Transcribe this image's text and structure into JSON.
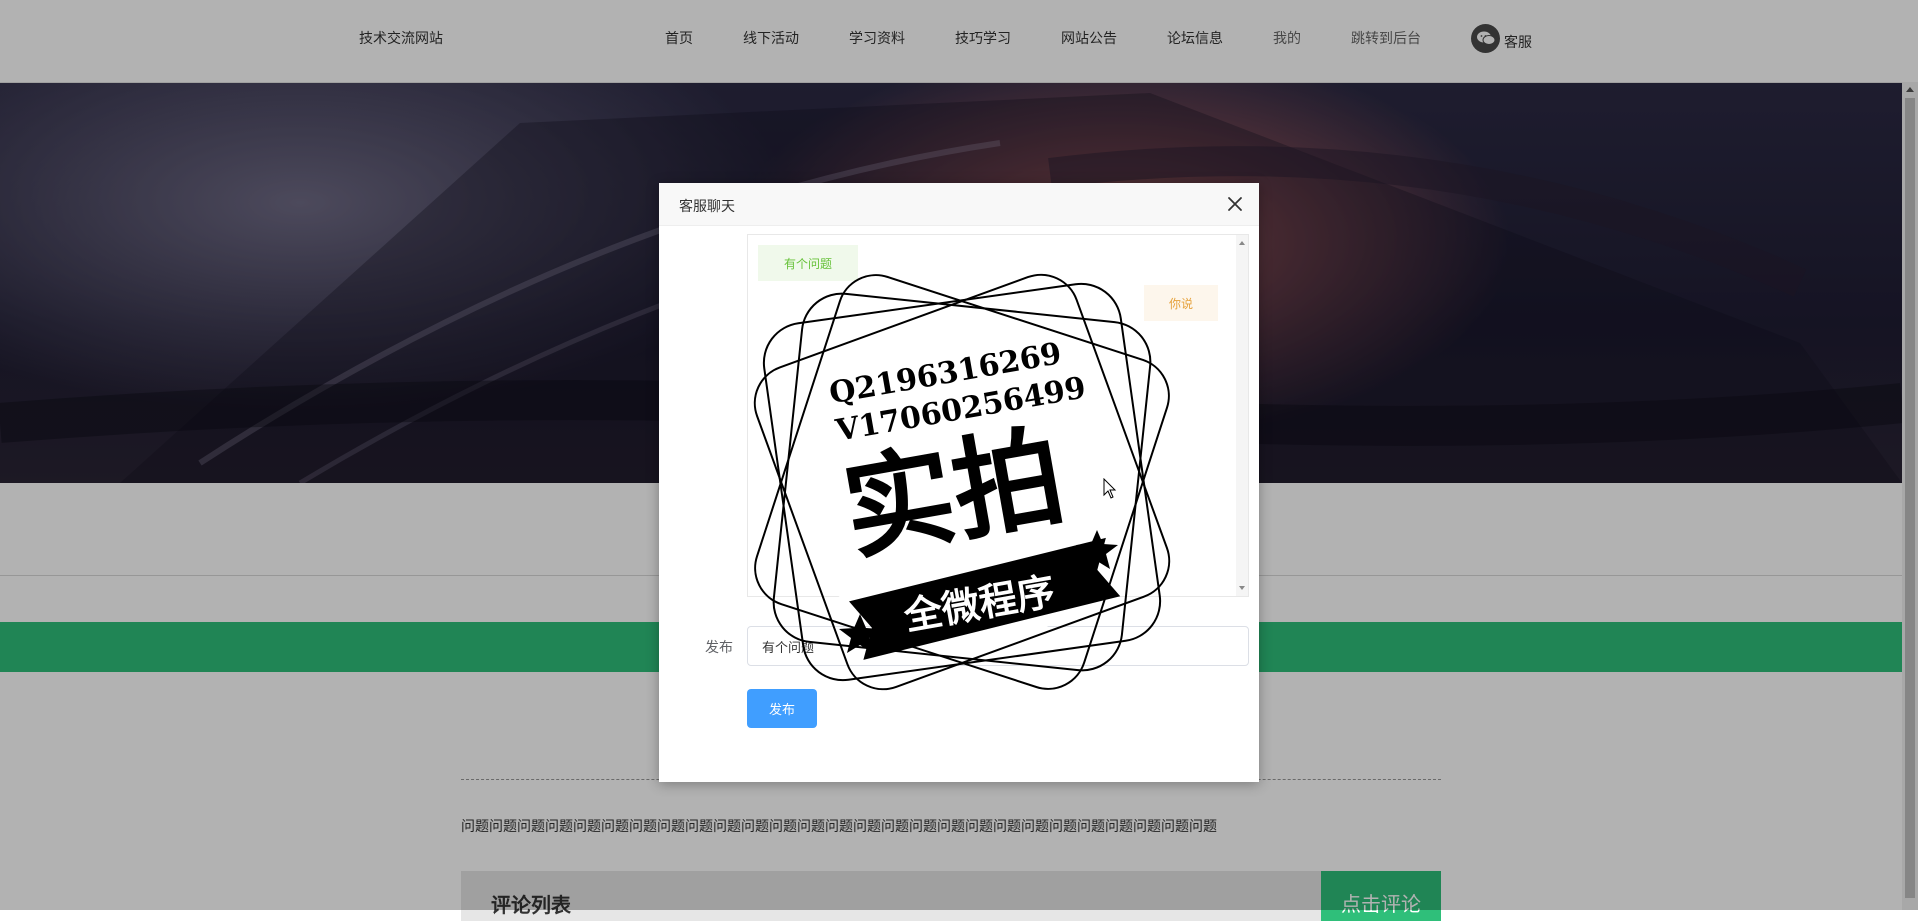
{
  "header": {
    "site_title": "技术交流网站",
    "nav": [
      "首页",
      "线下活动",
      "学习资料",
      "技巧学习",
      "网站公告",
      "论坛信息",
      "我的",
      "跳转到后台"
    ],
    "service_label": "客服"
  },
  "page": {
    "question_text": "问题问题问题问题问题问题问题问题问题问题问题问题问题问题问题问题问题问题问题问题问题问题问题问题问题问题问题",
    "comment_list_title": "评论列表",
    "comment_button": "点击评论"
  },
  "dialog": {
    "title": "客服聊天",
    "messages": [
      {
        "side": "left",
        "text": "有个问题"
      },
      {
        "side": "right",
        "text": "你说"
      }
    ],
    "form_label": "发布",
    "input_value": "有个问题",
    "submit_label": "发布"
  },
  "watermark": {
    "line1": "Q2196316269",
    "line2": "V17060256499",
    "main": "实拍",
    "ribbon": "全微程序"
  },
  "colors": {
    "accent_green": "#2fbf7a",
    "primary_blue": "#409eff",
    "bubble_left_text": "#67c23a",
    "bubble_right_text": "#e6a23c"
  }
}
